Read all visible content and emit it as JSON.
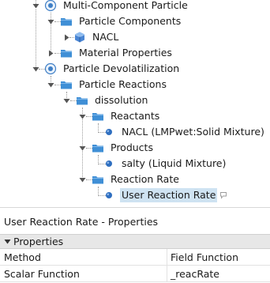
{
  "tree": {
    "nodes": [
      {
        "label": "Multi-Component Particle",
        "icon": "particle-target-icon"
      },
      {
        "label": "Particle Components",
        "icon": "folder-icon"
      },
      {
        "label": "NACL",
        "icon": "cube-icon"
      },
      {
        "label": "Material Properties",
        "icon": "folder-icon"
      },
      {
        "label": "Particle Devolatilization",
        "icon": "particle-target-icon"
      },
      {
        "label": "Particle Reactions",
        "icon": "folder-icon"
      },
      {
        "label": "dissolution",
        "icon": "folder-icon"
      },
      {
        "label": "Reactants",
        "icon": "folder-icon"
      },
      {
        "label": "NACL  (LMPwet:Solid Mixture)",
        "icon": "blue-dot-icon"
      },
      {
        "label": "Products",
        "icon": "folder-icon"
      },
      {
        "label": "salty  (Liquid Mixture)",
        "icon": "blue-dot-icon"
      },
      {
        "label": "Reaction Rate",
        "icon": "folder-icon"
      },
      {
        "label": "User Reaction Rate",
        "icon": "blue-dot-icon",
        "selected": true
      }
    ]
  },
  "properties": {
    "title": "User Reaction Rate - Properties",
    "section": "Properties",
    "rows": [
      {
        "key": "Method",
        "value": "Field Function"
      },
      {
        "key": "Scalar Function",
        "value": "_reacRate"
      }
    ]
  },
  "colors": {
    "folder": "#3f8fd6",
    "dot": "#2f6fc0",
    "selection": "#cfe3f2",
    "section_header": "#e7e7e7"
  }
}
